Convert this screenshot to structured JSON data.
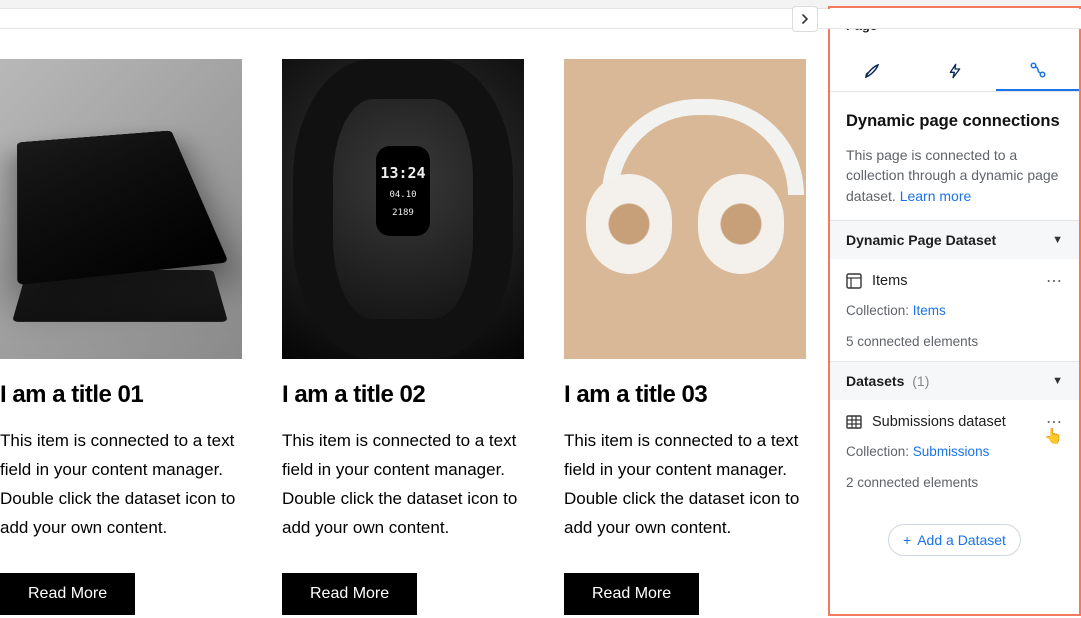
{
  "panel": {
    "header": "Page",
    "title": "Dynamic page connections",
    "desc": "This page is connected to a collection through a dynamic page dataset. ",
    "learn_more": "Learn more",
    "sections": {
      "dynamic": {
        "head": "Dynamic Page Dataset",
        "item_label": "Items",
        "collection_prefix": "Collection: ",
        "collection_link": "Items",
        "connected": "5 connected elements"
      },
      "datasets": {
        "head": "Datasets",
        "count": "(1)",
        "item_label": "Submissions dataset",
        "collection_prefix": "Collection: ",
        "collection_link": "Submissions",
        "connected": "2 connected elements"
      }
    },
    "add_dataset": "Add a Dataset"
  },
  "watch": {
    "time": "13:24",
    "date": "04.10",
    "steps": "2189"
  },
  "cards": [
    {
      "title": "I am a title 01",
      "desc": "This item is connected to a text field in your content manager. Double click the dataset icon to add your own content.",
      "btn": "Read More"
    },
    {
      "title": "I am a title 02",
      "desc": "This item is connected to a text field in your content manager. Double click the dataset icon to add your own content.",
      "btn": "Read More"
    },
    {
      "title": "I am a title 03",
      "desc": "This item is connected to a text field in your content manager. Double click the dataset icon to add your own content.",
      "btn": "Read More"
    }
  ]
}
